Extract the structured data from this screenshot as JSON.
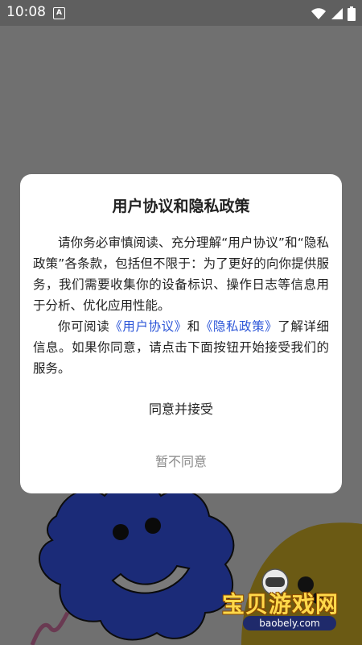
{
  "status_bar": {
    "time": "10:08",
    "notification_badge": "A",
    "icons": [
      "wifi-icon",
      "cellular-signal-icon",
      "battery-icon"
    ]
  },
  "dialog": {
    "title": "用户协议和隐私政策",
    "para1": "请你务必审慎阅读、充分理解“用户协议”和“隐私政策”各条款，包括但不限于：为了更好的向你提供服务，我们需要收集你的设备标识、操作日志等信息用于分析、优化应用性能。",
    "para2_prefix": "你可阅读",
    "user_agreement_link": "《用户协议》",
    "para2_and": "和",
    "privacy_policy_link": "《隐私政策》",
    "para2_suffix": "了解详细信息。如果你同意，请点击下面按钮开始接受我们的服务。",
    "agree_button": "同意并接受",
    "disagree_button": "暂不同意"
  },
  "watermark": {
    "brand": "宝贝游戏网",
    "url": "baobely.com"
  },
  "colors": {
    "overlay": "#707070",
    "link": "#2b55d8",
    "dialog_bg": "#ffffff",
    "disagree_text": "#8a8a8a"
  }
}
